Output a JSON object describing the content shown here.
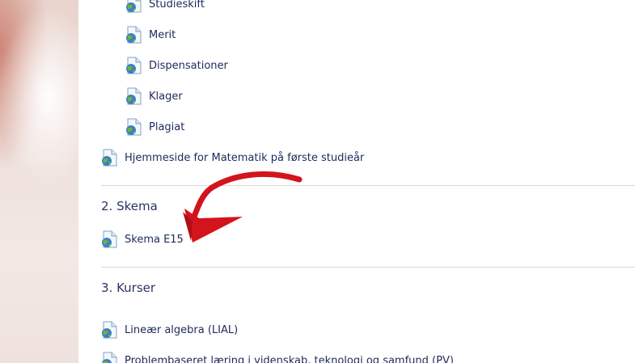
{
  "sub_items": [
    {
      "label": "Studieskift",
      "icon": "web-page-icon"
    },
    {
      "label": "Merit",
      "icon": "web-page-icon"
    },
    {
      "label": "Dispensationer",
      "icon": "web-page-icon"
    },
    {
      "label": "Klager",
      "icon": "web-page-icon"
    },
    {
      "label": "Plagiat",
      "icon": "web-page-icon"
    }
  ],
  "homepage_link": {
    "label": "Hjemmeside for Matematik på første studieår",
    "icon": "web-page-icon"
  },
  "sections": [
    {
      "title": "2. Skema",
      "items": [
        {
          "label": "Skema E15",
          "icon": "web-page-icon"
        }
      ]
    },
    {
      "title": "3. Kurser",
      "items": [
        {
          "label": "Lineær algebra (LIAL)",
          "icon": "web-page-icon"
        },
        {
          "label": "Problembaseret læring i videnskab, teknologi og samfund (PV)",
          "icon": "web-page-icon"
        }
      ]
    }
  ],
  "colors": {
    "link_text": "#1e2a5a",
    "annotation_arrow": "#d3141c",
    "divider": "#d9d9d9"
  }
}
